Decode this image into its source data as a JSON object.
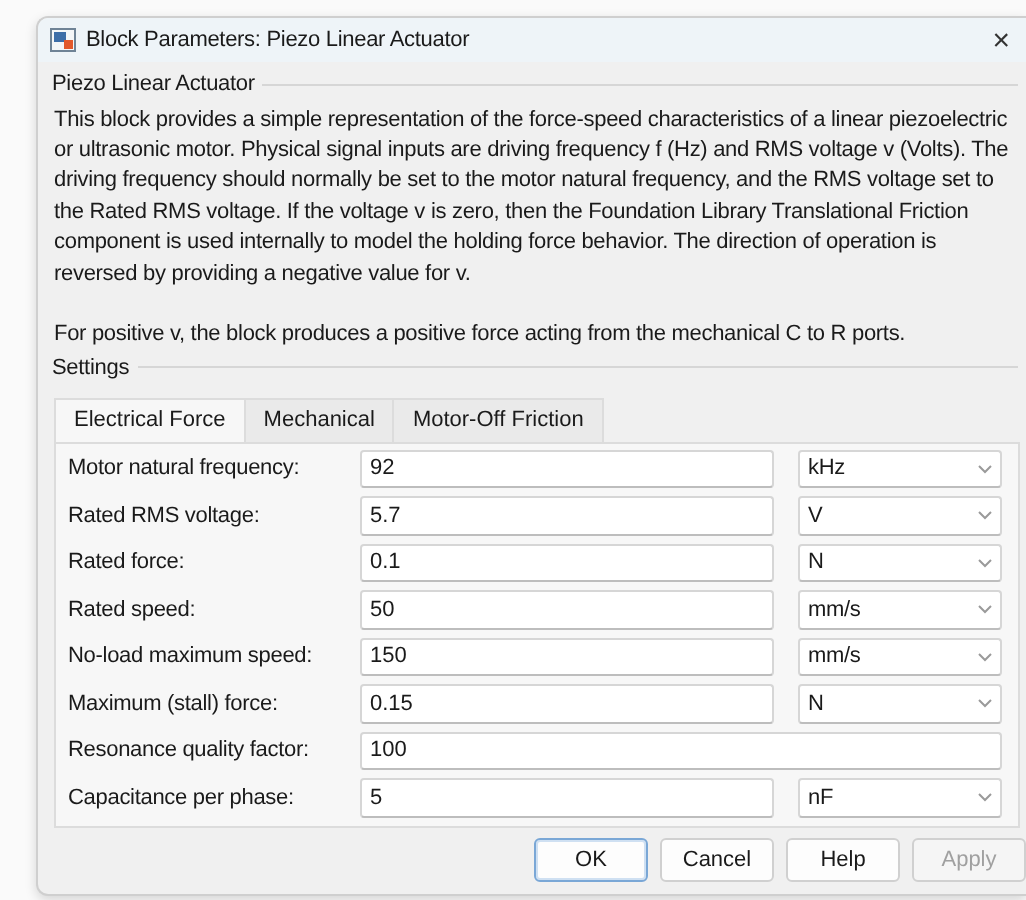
{
  "window": {
    "title": "Block Parameters: Piezo Linear Actuator",
    "close": "×"
  },
  "description": {
    "heading": "Piezo Linear Actuator",
    "paragraphs": [
      "This block provides a simple representation of the force-speed characteristics of a linear piezoelectric or ultrasonic motor. Physical signal inputs are driving frequency f (Hz) and RMS voltage v (Volts). The driving frequency should normally be set to the motor natural frequency, and the RMS voltage set to the Rated RMS voltage. If the voltage v is zero, then the Foundation Library Translational Friction component is used internally to model the holding force behavior. The direction of operation is reversed by providing a negative value for v.",
      "For positive v, the block produces a positive force acting from the mechanical C to R ports."
    ]
  },
  "settings": {
    "heading": "Settings",
    "tabs": [
      {
        "label": "Electrical Force",
        "selected": true
      },
      {
        "label": "Mechanical",
        "selected": false
      },
      {
        "label": "Motor-Off Friction",
        "selected": false
      }
    ],
    "parameters": [
      {
        "label": "Motor natural frequency:",
        "value": "92",
        "unit": "kHz"
      },
      {
        "label": "Rated RMS voltage:",
        "value": "5.7",
        "unit": "V"
      },
      {
        "label": "Rated force:",
        "value": "0.1",
        "unit": "N"
      },
      {
        "label": "Rated speed:",
        "value": "50",
        "unit": "mm/s"
      },
      {
        "label": "No-load maximum speed:",
        "value": "150",
        "unit": "mm/s"
      },
      {
        "label": "Maximum (stall) force:",
        "value": "0.15",
        "unit": "N"
      },
      {
        "label": "Resonance quality factor:",
        "value": "100"
      },
      {
        "label": "Capacitance per phase:",
        "value": "5",
        "unit": "nF"
      }
    ]
  },
  "buttons": [
    {
      "label": "OK",
      "default": true,
      "disabled": false
    },
    {
      "label": "Cancel",
      "default": false,
      "disabled": false
    },
    {
      "label": "Help",
      "default": false,
      "disabled": false
    },
    {
      "label": "Apply",
      "default": false,
      "disabled": true
    }
  ]
}
